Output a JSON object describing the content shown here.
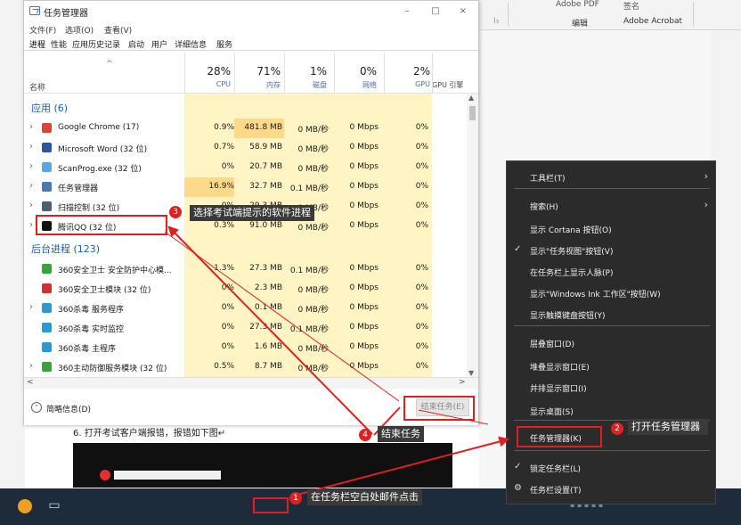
{
  "background": {
    "ribbon_top": [
      "Adobe PDF",
      "签名"
    ],
    "ribbon_labels": [
      "编辑",
      "Adobe Acrobat"
    ],
    "doc_line": "6. 打开考试客户端报错，报错如下图↵"
  },
  "task_manager": {
    "title": "任务管理器",
    "window_controls": [
      "–",
      "□",
      "×"
    ],
    "menu": [
      "文件(F)",
      "选项(O)",
      "查看(V)"
    ],
    "tabs": [
      "进程",
      "性能",
      "应用历史记录",
      "启动",
      "用户",
      "详细信息",
      "服务"
    ],
    "sort_caret": "^",
    "columns": {
      "name": "名称",
      "cpu": {
        "pct": "28%",
        "label": "CPU"
      },
      "mem": {
        "pct": "71%",
        "label": "内存"
      },
      "disk": {
        "pct": "1%",
        "label": "磁盘"
      },
      "net": {
        "pct": "0%",
        "label": "网络"
      },
      "gpu": {
        "pct": "2%",
        "label": "GPU"
      },
      "gpu_engine": "GPU 引擎"
    },
    "group_apps": "应用 (6)",
    "group_bg": "后台进程 (123)",
    "apps": [
      {
        "name": "Google Chrome (17)",
        "cpu": "0.9%",
        "mem": "481.8 MB",
        "disk": "0 MB/秒",
        "net": "0 Mbps",
        "gpu": "0%",
        "icon": "chrome-icon",
        "color": "#db4437"
      },
      {
        "name": "Microsoft Word (32 位)",
        "cpu": "0.7%",
        "mem": "58.9 MB",
        "disk": "0 MB/秒",
        "net": "0 Mbps",
        "gpu": "0%",
        "icon": "word-icon",
        "color": "#2b579a"
      },
      {
        "name": "ScanProg.exe (32 位)",
        "cpu": "0%",
        "mem": "20.7 MB",
        "disk": "0 MB/秒",
        "net": "0 Mbps",
        "gpu": "0%",
        "icon": "scanprog-icon",
        "color": "#5aa8e0"
      },
      {
        "name": "任务管理器",
        "cpu": "16.9%",
        "mem": "32.7 MB",
        "disk": "0.1 MB/秒",
        "net": "0 Mbps",
        "gpu": "0%",
        "icon": "task-manager-icon",
        "color": "#4a78b0"
      },
      {
        "name": "扫描控制 (32 位)",
        "cpu": "0%",
        "mem": "29.3 MB",
        "disk": "0 MB/秒",
        "net": "0 Mbps",
        "gpu": "0%",
        "icon": "scan-control-icon",
        "color": "#4a6070"
      },
      {
        "name": "腾讯QQ (32 位)",
        "cpu": "0.3%",
        "mem": "91.0 MB",
        "disk": "0 MB/秒",
        "net": "0 Mbps",
        "gpu": "0%",
        "icon": "qq-icon",
        "color": "#111111"
      }
    ],
    "bg_processes": [
      {
        "name": "360安全卫士 安全防护中心模...",
        "cpu": "1.3%",
        "mem": "27.3 MB",
        "disk": "0.1 MB/秒",
        "net": "0 Mbps",
        "gpu": "0%",
        "icon": "360-shield-icon",
        "color": "#3aa23a"
      },
      {
        "name": "360安全卫士模块 (32 位)",
        "cpu": "0%",
        "mem": "2.3 MB",
        "disk": "0 MB/秒",
        "net": "0 Mbps",
        "gpu": "0%",
        "icon": "360-module-icon",
        "color": "#d03030"
      },
      {
        "name": "360杀毒 服务程序",
        "cpu": "0%",
        "mem": "0.1 MB",
        "disk": "0 MB/秒",
        "net": "0 Mbps",
        "gpu": "0%",
        "icon": "360-av-icon",
        "color": "#2a9ad0"
      },
      {
        "name": "360杀毒 实时监控",
        "cpu": "0%",
        "mem": "27.3 MB",
        "disk": "0.1 MB/秒",
        "net": "0 Mbps",
        "gpu": "0%",
        "icon": "360-monitor-icon",
        "color": "#2a9ad0"
      },
      {
        "name": "360杀毒 主程序",
        "cpu": "0%",
        "mem": "1.6 MB",
        "disk": "0 MB/秒",
        "net": "0 Mbps",
        "gpu": "0%",
        "icon": "360-main-icon",
        "color": "#2a9ad0"
      },
      {
        "name": "360主动防御服务模块 (32 位)",
        "cpu": "0.5%",
        "mem": "8.7 MB",
        "disk": "0 MB/秒",
        "net": "0 Mbps",
        "gpu": "0%",
        "icon": "360-defense-icon",
        "color": "#3aa23a"
      }
    ],
    "fewer_details": "简略信息(D)",
    "end_task": "结束任务(E)"
  },
  "context_menu": {
    "items": [
      {
        "label": "工具栏(T)",
        "submenu": true
      },
      {
        "label": "搜索(H)",
        "submenu": true
      },
      {
        "label": "显示 Cortana 按钮(O)"
      },
      {
        "label": "显示\"任务视图\"按钮(V)",
        "checked": true
      },
      {
        "label": "在任务栏上显示人脉(P)"
      },
      {
        "label": "显示\"Windows Ink 工作区\"按钮(W)"
      },
      {
        "label": "显示触摸键盘按钮(Y)"
      },
      {
        "label": "层叠窗口(D)"
      },
      {
        "label": "堆叠显示窗口(E)"
      },
      {
        "label": "并排显示窗口(I)"
      },
      {
        "label": "显示桌面(S)"
      },
      {
        "label": "任务管理器(K)"
      },
      {
        "label": "锁定任务栏(L)",
        "checked": true
      },
      {
        "label": "任务栏设置(T)",
        "gear": true
      }
    ]
  },
  "annotations": [
    {
      "num": "1",
      "text": "在任务栏空白处邮件点击"
    },
    {
      "num": "2",
      "text": "打开任务管理器"
    },
    {
      "num": "3",
      "text": "选择考试端提示的软件进程"
    },
    {
      "num": "4",
      "text": "结束任务"
    }
  ],
  "colors": {
    "accent_red": "#e02020",
    "heat_yellow": "#fff4c4",
    "heat_orange": "#ffd98a",
    "link_blue": "#1a5fb4"
  }
}
